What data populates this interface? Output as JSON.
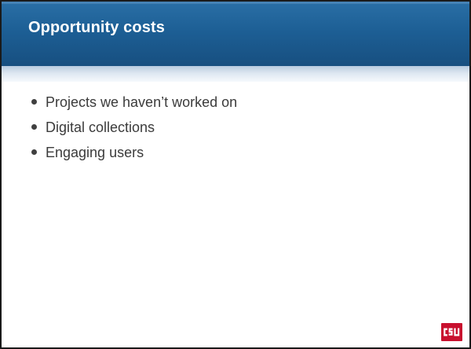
{
  "slide": {
    "title": "Opportunity costs",
    "bullets": [
      "Projects we haven’t worked on",
      "Digital collections",
      "Engaging users"
    ],
    "logo_text": "CSU"
  },
  "colors": {
    "title_bar": "#1d5f95",
    "title_text": "#ffffff",
    "body_text": "#3b3b3b",
    "logo_background": "#c8102e"
  }
}
